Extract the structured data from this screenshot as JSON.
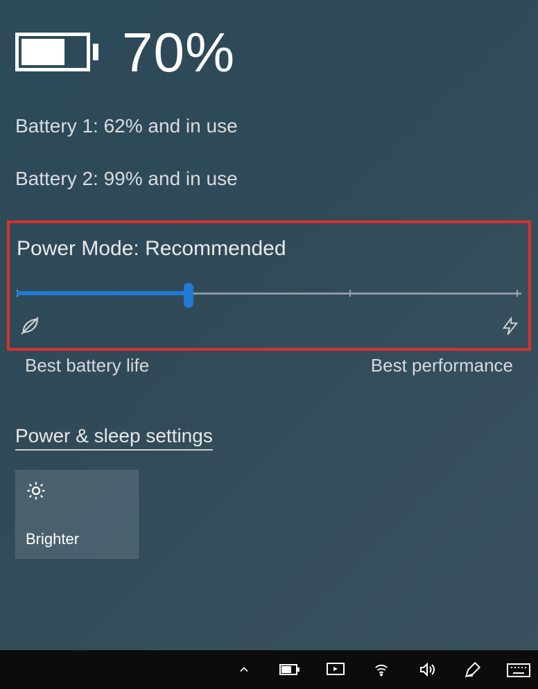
{
  "header": {
    "percent_text": "70%",
    "battery_fill_percent": 62
  },
  "batteries": [
    "Battery 1: 62% and in use",
    "Battery 2: 99% and in use"
  ],
  "power_mode": {
    "label": "Power Mode: Recommended",
    "slider_percent": 34,
    "left_label": "Best battery life",
    "right_label": "Best performance"
  },
  "settings_link": "Power & sleep settings",
  "brightness_tile": {
    "label": "Brighter"
  },
  "tray": {
    "chevron": "chevron-up",
    "items": [
      "battery",
      "cast",
      "wifi",
      "volume",
      "pen",
      "keyboard"
    ]
  }
}
